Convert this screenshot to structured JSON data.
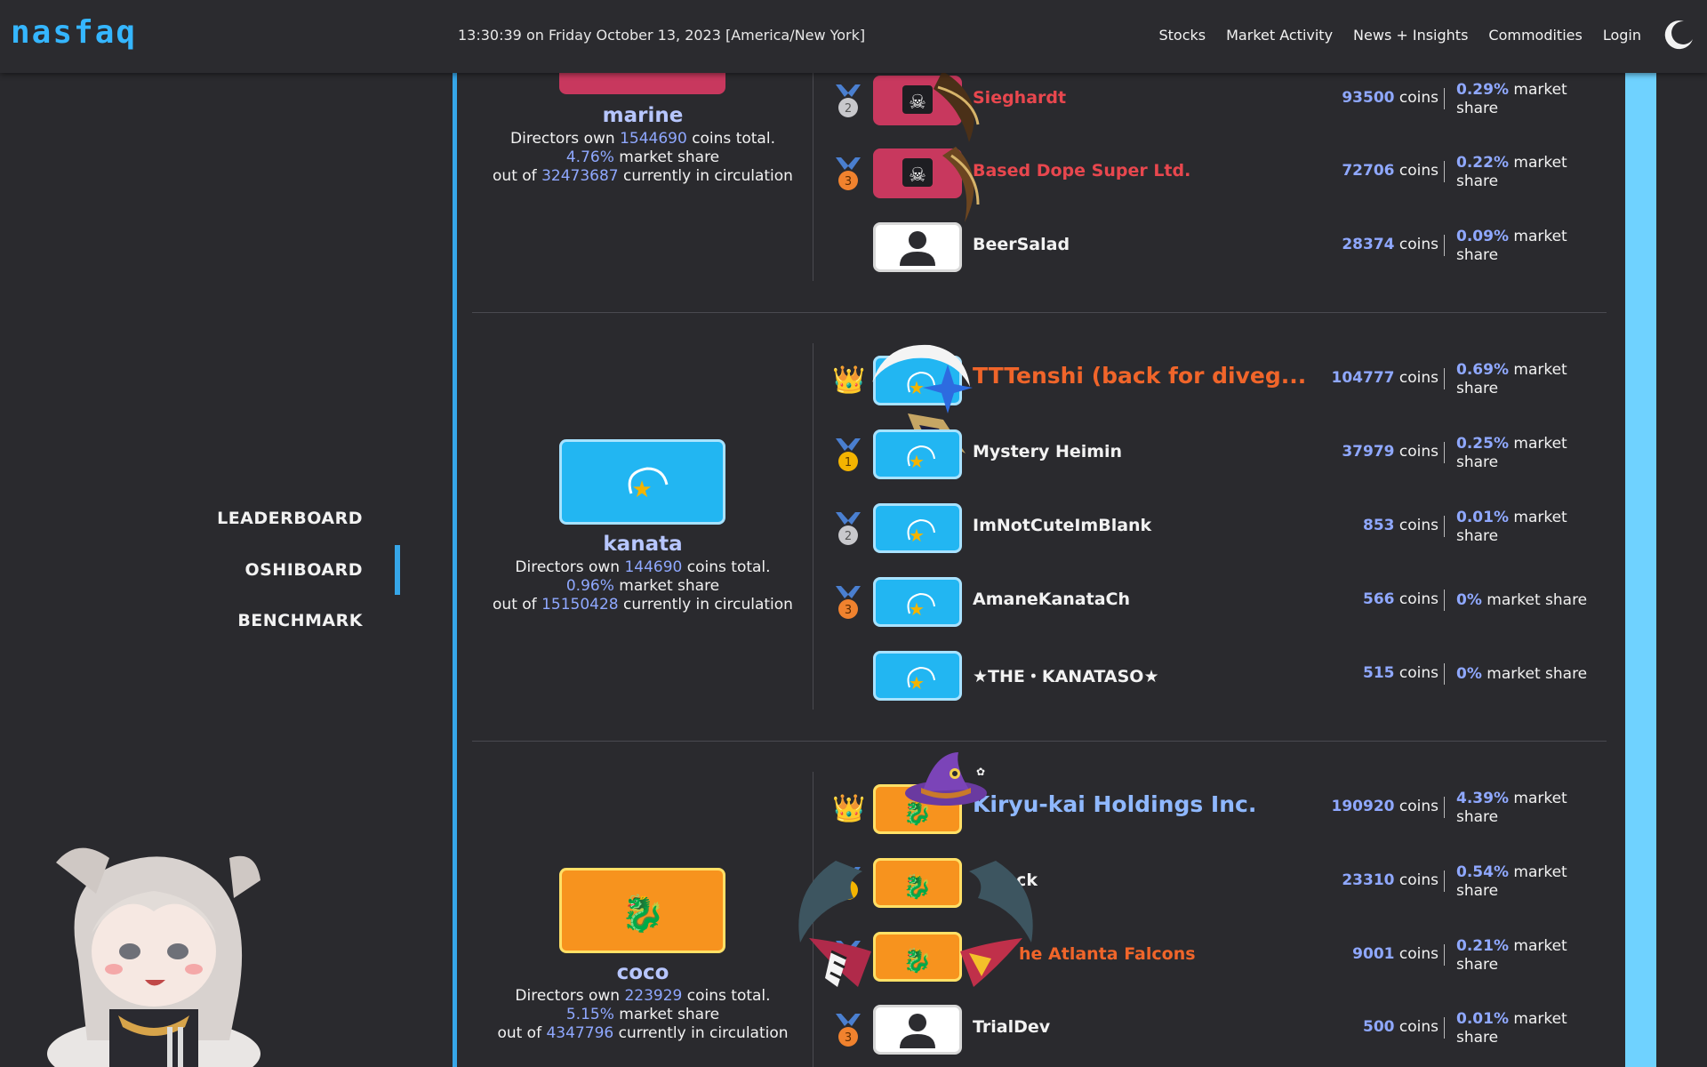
{
  "header": {
    "logo": "nasfaq",
    "clock": "13:30:39 on Friday October 13, 2023 [America/New York]",
    "nav": [
      "Stocks",
      "Market Activity",
      "News + Insights",
      "Commodities",
      "Login"
    ]
  },
  "sidebar": {
    "items": [
      "LEADERBOARD",
      "OSHIBOARD",
      "BENCHMARK"
    ],
    "active": "OSHIBOARD"
  },
  "colors": {
    "accent": "#36a6e8",
    "marine": "#c8385e",
    "kanata": "#22b6f2",
    "coco": "#f7931e",
    "highlight": "#8fa8ff"
  },
  "sections": [
    {
      "name": "marine",
      "directors_coins": "1544690",
      "market_share": "4.76%",
      "circulation": "32473687",
      "text": {
        "own_prefix": "Directors own",
        "own_suffix": "coins total.",
        "share_suffix": "market share",
        "circ_prefix": "out of",
        "circ_suffix": "currently in circulation"
      },
      "rows": [
        {
          "medal": "2",
          "name": "Sieghardt",
          "coins": "93500",
          "share": "0.29%",
          "name_color": "#e8474e"
        },
        {
          "medal": "3",
          "name": "Based Dope Super Ltd.",
          "coins": "72706",
          "share": "0.22%",
          "name_color": "#e8474e"
        },
        {
          "medal": "",
          "name": "BeerSalad",
          "coins": "28374",
          "share": "0.09%",
          "name_color": "#f2f2f2"
        }
      ]
    },
    {
      "name": "kanata",
      "directors_coins": "144690",
      "market_share": "0.96%",
      "circulation": "15150428",
      "rows": [
        {
          "medal": "crown",
          "name": "TTTenshi (back for diveg...",
          "coins": "104777",
          "share": "0.69%",
          "name_color": "#f0652a"
        },
        {
          "medal": "1",
          "name": "Mystery Heimin",
          "coins": "37979",
          "share": "0.25%",
          "name_color": "#f2f2f2"
        },
        {
          "medal": "2",
          "name": "ImNotCuteImBlank",
          "coins": "853",
          "share": "0.01%",
          "name_color": "#f2f2f2"
        },
        {
          "medal": "3",
          "name": "AmaneKanataCh",
          "coins": "566",
          "share": "0%",
          "name_color": "#f2f2f2"
        },
        {
          "medal": "",
          "name": "★THE・KANATASO★",
          "coins": "515",
          "share": "0%",
          "name_color": "#f2f2f2"
        }
      ]
    },
    {
      "name": "coco",
      "directors_coins": "223929",
      "market_share": "5.15%",
      "circulation": "4347796",
      "rows": [
        {
          "medal": "crown",
          "name": "Kiryu-kai Holdings Inc.",
          "coins": "190920",
          "share": "4.39%",
          "name_color": "#8fb8ff"
        },
        {
          "medal": "1",
          "name": "ock",
          "coins": "23310",
          "share": "0.54%",
          "name_color": "#f2f2f2"
        },
        {
          "medal": "2",
          "name": "he Atlanta Falcons",
          "coins": "9001",
          "share": "0.21%",
          "name_color": "#f0652a"
        },
        {
          "medal": "3",
          "name": "TrialDev",
          "coins": "500",
          "share": "0.01%",
          "name_color": "#f2f2f2"
        }
      ]
    }
  ],
  "labels": {
    "coins": "coins",
    "market_share": "market share",
    "market": "market",
    "share": "share"
  }
}
